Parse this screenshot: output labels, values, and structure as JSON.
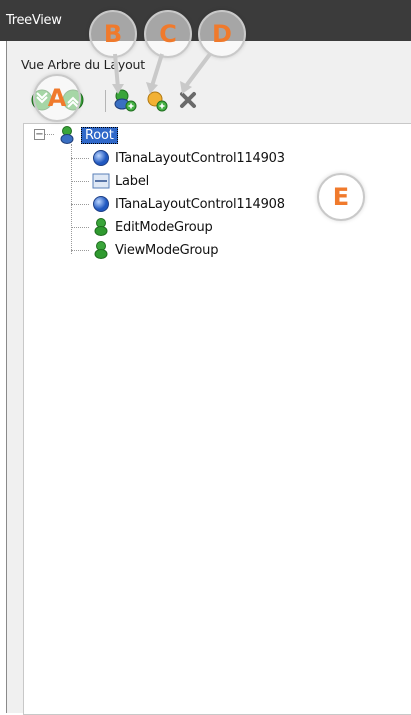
{
  "window": {
    "title": "TreeView"
  },
  "panel": {
    "label": "Vue Arbre du Layout"
  },
  "toolbar": {
    "buttons": [
      {
        "name": "expand-collapse-all",
        "icon": "expand-collapse-icon"
      },
      {
        "name": "add-group",
        "icon": "add-group-icon"
      },
      {
        "name": "add-item",
        "icon": "add-item-icon"
      },
      {
        "name": "delete",
        "icon": "delete-icon"
      }
    ]
  },
  "tree": {
    "root": {
      "label": "Root",
      "expander": "−"
    },
    "children": [
      {
        "label": "ITanaLayoutControl114903",
        "icon": "blue-sphere-icon"
      },
      {
        "label": "Label",
        "icon": "label-icon"
      },
      {
        "label": "ITanaLayoutControl114908",
        "icon": "blue-sphere-icon"
      },
      {
        "label": "EditModeGroup",
        "icon": "group-icon"
      },
      {
        "label": "ViewModeGroup",
        "icon": "group-icon"
      }
    ]
  },
  "callouts": {
    "a": "A",
    "b": "B",
    "c": "C",
    "d": "D",
    "e": "E"
  },
  "colors": {
    "accent": "#f07a2c",
    "selection": "#2f68c9",
    "titlebar": "#3b3b3b"
  }
}
